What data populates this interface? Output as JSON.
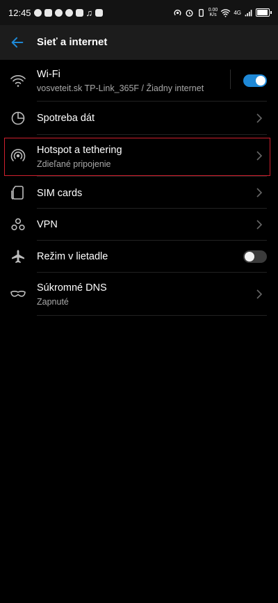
{
  "status": {
    "time": "12:45",
    "speed_value": "0.00",
    "speed_unit": "K/s",
    "network": "4G"
  },
  "header": {
    "title": "Sieť a internet",
    "back_icon": "arrow-left-icon"
  },
  "items": [
    {
      "icon": "wifi-icon",
      "label": "Wi-Fi",
      "subtitle": "vosveteit.sk TP-Link_365F / Žiadny internet",
      "control": "toggle",
      "toggle_on": true
    },
    {
      "icon": "data-usage-icon",
      "label": "Spotreba dát",
      "control": "chevron"
    },
    {
      "icon": "hotspot-icon",
      "label": "Hotspot a tethering",
      "subtitle": "Zdieľané pripojenie",
      "control": "chevron",
      "highlighted": true
    },
    {
      "icon": "sim-card-icon",
      "label": "SIM cards",
      "control": "chevron"
    },
    {
      "icon": "vpn-icon",
      "label": "VPN",
      "control": "chevron"
    },
    {
      "icon": "airplane-icon",
      "label": "Režim v lietadle",
      "control": "toggle",
      "toggle_on": false
    },
    {
      "icon": "private-dns-icon",
      "label": "Súkromné DNS",
      "subtitle": "Zapnuté",
      "control": "chevron"
    }
  ],
  "colors": {
    "accent": "#1e88d6",
    "highlight_border": "#d0202e",
    "background": "#000000",
    "appbar": "#1c1c1c",
    "secondary_text": "#a9a9a9"
  }
}
